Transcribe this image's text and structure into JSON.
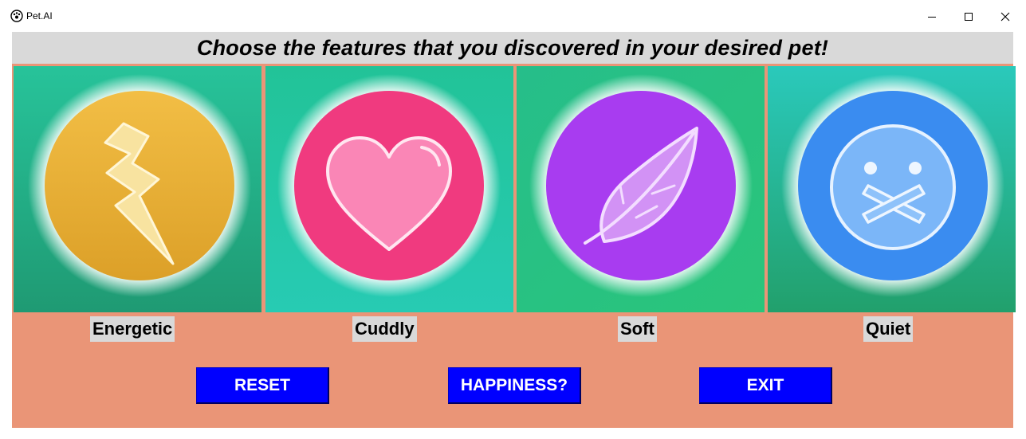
{
  "window": {
    "title": "Pet.AI",
    "app_icon": "pet-ai-icon",
    "controls": [
      "minimize-icon",
      "maximize-icon",
      "close-icon"
    ]
  },
  "header": {
    "title": "Choose the features that you discovered in your desired pet!"
  },
  "features": [
    {
      "label": "Energetic",
      "icon": "lightning-bolt-icon",
      "circle_color": "#f0b840"
    },
    {
      "label": "Cuddly",
      "icon": "heart-icon",
      "circle_color": "#f23d80"
    },
    {
      "label": "Soft",
      "icon": "feather-icon",
      "circle_color": "#a93ef0"
    },
    {
      "label": "Quiet",
      "icon": "mute-face-icon",
      "circle_color": "#3a8ef0"
    }
  ],
  "buttons": {
    "reset": "RESET",
    "happiness": "HAPPINESS?",
    "exit": "EXIT"
  },
  "colors": {
    "background": "#ea9577",
    "header_bg": "#d9d9d9",
    "button_bg": "#0000ff",
    "tile_green": "#2ec596"
  }
}
